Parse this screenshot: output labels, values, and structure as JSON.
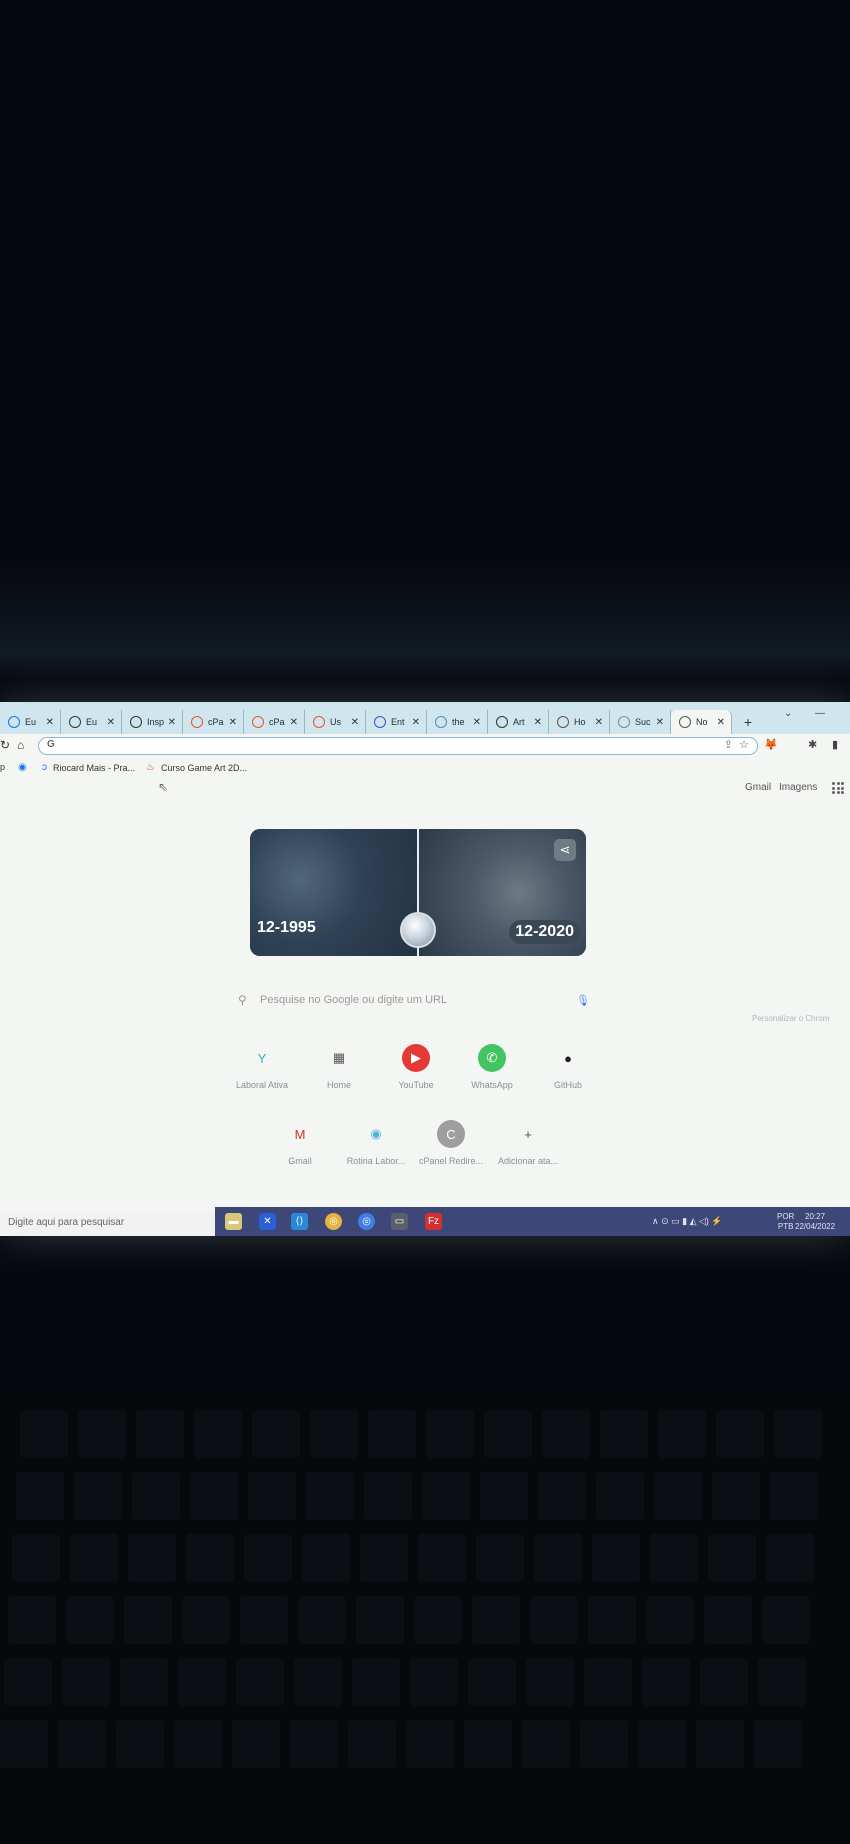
{
  "tabs": [
    {
      "icon": "chrome-icon",
      "label": "Eu",
      "color": "#1a73e8"
    },
    {
      "icon": "globe-icon",
      "label": "Eu",
      "color": "#333"
    },
    {
      "icon": "globe-icon",
      "label": "Insp",
      "color": "#333"
    },
    {
      "icon": "cpanel-icon",
      "label": "cPa",
      "color": "#e8562a"
    },
    {
      "icon": "cpanel-icon",
      "label": "cPa",
      "color": "#e8562a"
    },
    {
      "icon": "cpanel-icon",
      "label": "Us",
      "color": "#e8562a"
    },
    {
      "icon": "bracket-icon",
      "label": "Ent",
      "color": "#3f51b5"
    },
    {
      "icon": "theme-icon",
      "label": "the",
      "color": "#5a8ab0"
    },
    {
      "icon": "globe-icon",
      "label": "Art",
      "color": "#333"
    },
    {
      "icon": "book-icon",
      "label": "Ho",
      "color": "#6d4c41"
    },
    {
      "icon": "blank-icon",
      "label": "Suc",
      "color": "#888"
    },
    {
      "icon": "google-icon",
      "label": "No",
      "color": "#555",
      "active": true
    }
  ],
  "toolbar": {
    "url": "G"
  },
  "bookmarks": [
    {
      "label": "p",
      "icon": ""
    },
    {
      "label": "",
      "icon": "◉"
    },
    {
      "label": "Riocard Mais - Pra...",
      "icon": "ↄ"
    },
    {
      "label": "Curso Game Art 2D...",
      "icon": "♨"
    }
  ],
  "google": {
    "gmail_link": "Gmail",
    "images_link": "Imagens",
    "doodle": {
      "left_year": "12-1995",
      "right_year": "12-2020"
    },
    "search_placeholder": "Pesquise no Google ou digite um URL",
    "shortcuts_row1": [
      {
        "label": "Laboral Ativa",
        "glyph": "Y",
        "color": "#2cb5c5",
        "bg": "transparent"
      },
      {
        "label": "Home",
        "glyph": "▦",
        "color": "#555",
        "bg": "transparent"
      },
      {
        "label": "YouTube",
        "glyph": "▶",
        "color": "#fff",
        "bg": "#e53935"
      },
      {
        "label": "WhatsApp",
        "glyph": "✆",
        "color": "#fff",
        "bg": "#43c463"
      },
      {
        "label": "GitHub",
        "glyph": "●",
        "color": "#222",
        "bg": "transparent"
      }
    ],
    "shortcuts_row2": [
      {
        "label": "Gmail",
        "glyph": "M",
        "color": "#d93025",
        "bg": "transparent"
      },
      {
        "label": "Rotina Labor...",
        "glyph": "◉",
        "color": "#4fb3d9",
        "bg": "transparent"
      },
      {
        "label": "cPanel Redire...",
        "glyph": "C",
        "color": "#fff",
        "bg": "#9e9e9e"
      },
      {
        "label": "Adicionar ata...",
        "glyph": "+",
        "color": "#555",
        "bg": "transparent"
      }
    ],
    "customize": "Personalizar o Chrom"
  },
  "taskbar": {
    "search_text": "Digite aqui para pesquisar",
    "lang_top": "POR",
    "lang_bottom": "PTB",
    "time": "20:27",
    "date": "22/04/2022"
  }
}
